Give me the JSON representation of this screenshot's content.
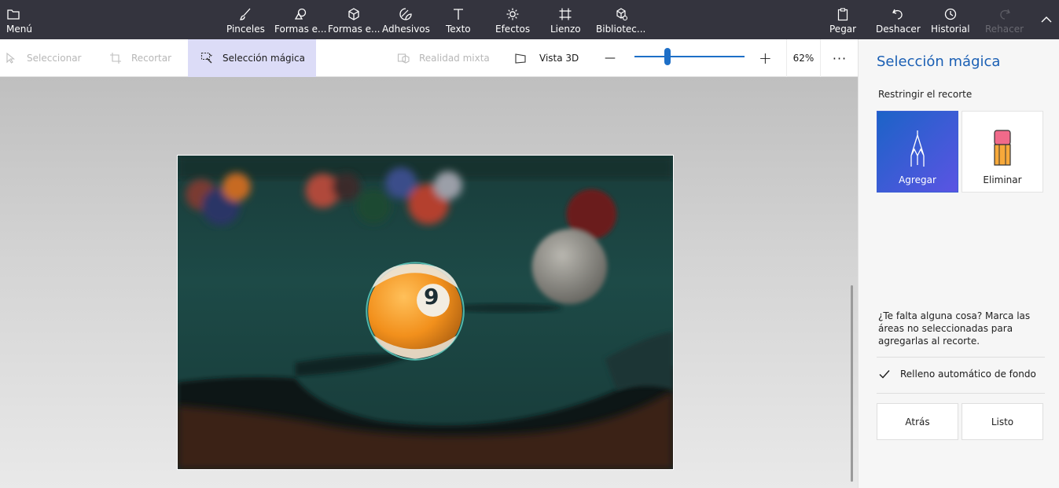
{
  "topbar": {
    "menu": "Menú",
    "tools": [
      {
        "label": "Pinceles",
        "icon": "brush-icon"
      },
      {
        "label": "Formas e...",
        "icon": "2d-shapes-icon"
      },
      {
        "label": "Formas e...",
        "icon": "3d-shapes-icon"
      },
      {
        "label": "Adhesivos",
        "icon": "stickers-icon"
      },
      {
        "label": "Texto",
        "icon": "text-icon"
      },
      {
        "label": "Efectos",
        "icon": "effects-icon"
      },
      {
        "label": "Lienzo",
        "icon": "canvas-icon"
      },
      {
        "label": "Bibliotec...",
        "icon": "library-icon"
      }
    ],
    "paste": "Pegar",
    "undo": "Deshacer",
    "history": "Historial",
    "redo": "Rehacer"
  },
  "subbar": {
    "select": "Seleccionar",
    "crop": "Recortar",
    "magic_select": "Selección mágica",
    "mixed_reality": "Realidad mixta",
    "view3d": "Vista 3D",
    "zoom_minus": "—",
    "zoom_plus": "+",
    "zoom_percent": "62%",
    "zoom_level": 0.3,
    "more": "···"
  },
  "panel": {
    "title": "Selección mágica",
    "subtitle": "Restringir el recorte",
    "add": "Agregar",
    "remove": "Eliminar",
    "help": "¿Te falta alguna cosa? Marca las áreas no seleccionadas para agregarlas al recorte.",
    "autofill": "Relleno automático de fondo",
    "autofill_checked": true,
    "back": "Atrás",
    "done": "Listo"
  },
  "photo": {
    "ball_number": "9"
  },
  "colors": {
    "accent": "#1e6fc7",
    "title_blue": "#1a5fb4",
    "topbar": "#34343e",
    "table_felt": "#1d4f4c"
  }
}
